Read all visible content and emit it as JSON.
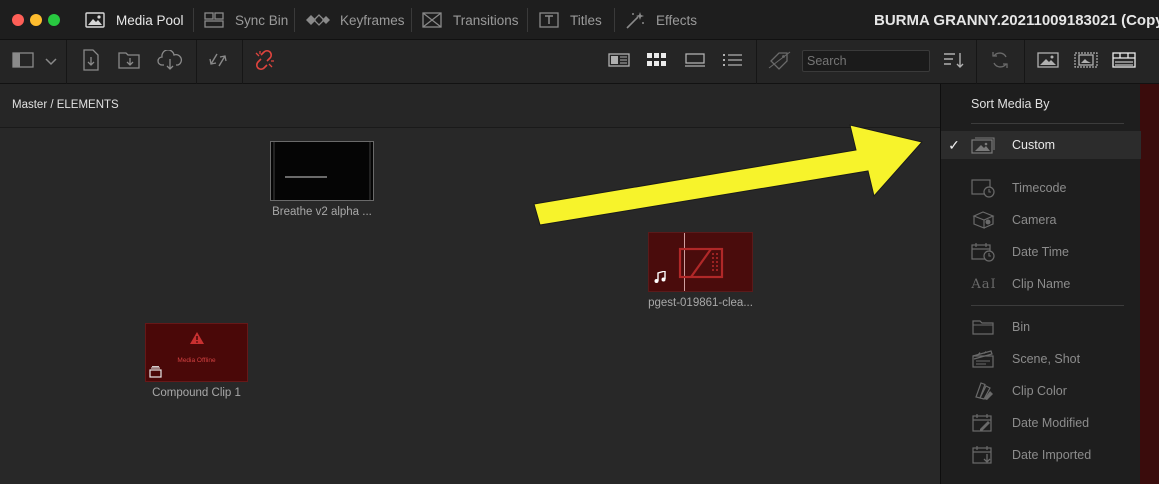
{
  "window": {
    "title": "BURMA GRANNY.20211009183021 (Copy"
  },
  "tabs": [
    {
      "label": "Media Pool",
      "icon": "media-pool-icon",
      "active": true
    },
    {
      "label": "Sync Bin",
      "icon": "sync-bin-icon",
      "active": false
    },
    {
      "label": "Keyframes",
      "icon": "keyframes-icon",
      "active": false
    },
    {
      "label": "Transitions",
      "icon": "transitions-icon",
      "active": false
    },
    {
      "label": "Titles",
      "icon": "titles-icon",
      "active": false
    },
    {
      "label": "Effects",
      "icon": "effects-icon",
      "active": false
    }
  ],
  "toolbar": {
    "search_placeholder": "Search",
    "accent_link_color": "#e0443e"
  },
  "breadcrumb": "Master / ELEMENTS",
  "clips": [
    {
      "label": "Breathe v2 alpha ...",
      "kind": "video"
    },
    {
      "label": "pgest-019861-clea...",
      "kind": "audio-offline"
    },
    {
      "label": "Compound Clip 1",
      "kind": "compound-offline",
      "badge": "Media Offline"
    }
  ],
  "sort_menu": {
    "header": "Sort Media By",
    "items": [
      {
        "label": "Custom",
        "icon": "custom-sort-icon",
        "selected": true
      },
      {
        "label": "Timecode",
        "icon": "timecode-icon",
        "selected": false
      },
      {
        "label": "Camera",
        "icon": "camera-icon",
        "selected": false
      },
      {
        "label": "Date Time",
        "icon": "date-time-icon",
        "selected": false
      },
      {
        "label": "Clip Name",
        "icon": "clip-name-icon",
        "selected": false
      },
      {
        "label": "Bin",
        "icon": "bin-icon",
        "selected": false
      },
      {
        "label": "Scene, Shot",
        "icon": "scene-shot-icon",
        "selected": false
      },
      {
        "label": "Clip Color",
        "icon": "clip-color-icon",
        "selected": false
      },
      {
        "label": "Date Modified",
        "icon": "date-modified-icon",
        "selected": false
      },
      {
        "label": "Date Imported",
        "icon": "date-imported-icon",
        "selected": false
      }
    ],
    "check_glyph": "✓",
    "clip_name_glyph": "AaI"
  },
  "annotation": {
    "arrow_color": "#f7f32b"
  }
}
